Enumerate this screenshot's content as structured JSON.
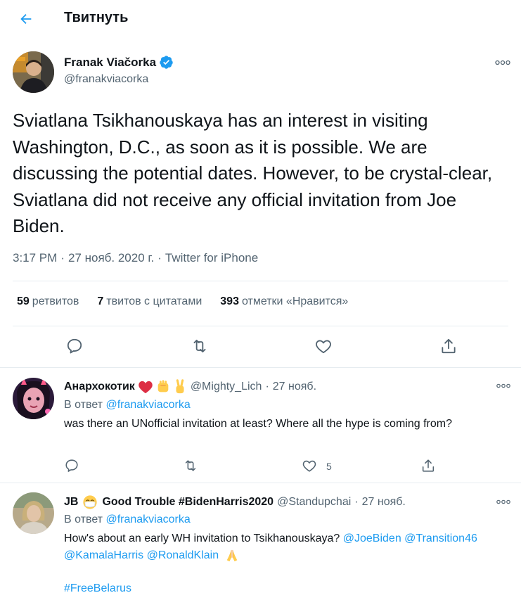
{
  "header": {
    "title": "Твитнуть"
  },
  "main_tweet": {
    "author_name": "Franak Viačorka",
    "author_handle": "@franakviacorka",
    "text": "Sviatlana Tsikhanouskaya has an interest in visiting Washington, D.C., as soon as it is possible. We are discussing the potential dates. However, to be crystal-clear, Sviatlana did not receive any official invitation from Joe Biden.",
    "time": "3:17 PM",
    "date": "27 нояб. 2020 г.",
    "separator": "·",
    "source": "Twitter for iPhone",
    "stats": {
      "retweets_count": "59",
      "retweets_label": "ретвитов",
      "quotes_count": "7",
      "quotes_label": "твитов с цитатами",
      "likes_count": "393",
      "likes_label": "отметки «Нравится»"
    }
  },
  "replies": [
    {
      "name": "Анархокотик",
      "handle": "@Mighty_Lich",
      "separator": "·",
      "time": "27 нояб.",
      "reply_to_label": "В ответ",
      "reply_to_handle": "@franakviacorka",
      "text": "was there an UNofficial invitation at least? Where all the hype is coming from?",
      "like_count": "5"
    },
    {
      "name_prefix": "JB",
      "name_suffix": "Good Trouble #BidenHarris2020",
      "handle": "@Standupchai",
      "separator": "·",
      "time": "27 нояб.",
      "reply_to_label": "В ответ",
      "reply_to_handle": "@franakviacorka",
      "text": "How's about an early WH invitation to Tsikhanouskaya?",
      "mention_1": "@JoeBiden",
      "mention_2": "@Transition46",
      "mention_3": "@KamalaHarris",
      "mention_4": "@RonaldKlain",
      "hashtag": "#FreeBelarus"
    }
  ],
  "colors": {
    "accent": "#1d9bf0",
    "text": "#0f1419",
    "secondary": "#536471",
    "divider": "#e6ecf0"
  },
  "icons": [
    "back-arrow-icon",
    "verified-badge-icon",
    "more-icon",
    "reply-icon",
    "retweet-icon",
    "like-icon",
    "share-icon",
    "heart-emoji",
    "fist-emoji",
    "victory-hand-emoji",
    "mask-face-emoji",
    "folded-hands-emoji"
  ]
}
